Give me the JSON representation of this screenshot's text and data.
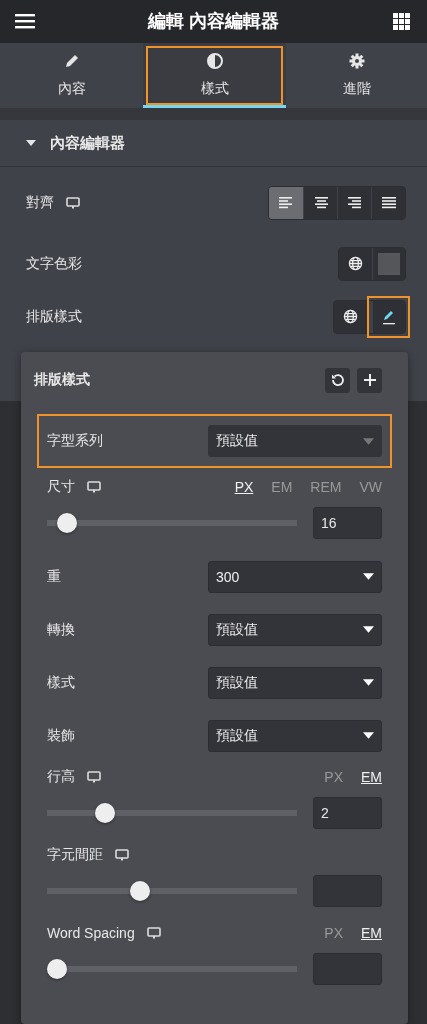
{
  "header": {
    "title": "編輯 內容編輯器"
  },
  "tabs": [
    {
      "label": "內容",
      "selected": false,
      "highlighted": false
    },
    {
      "label": "樣式",
      "selected": true,
      "highlighted": true
    },
    {
      "label": "進階",
      "selected": false,
      "highlighted": false
    }
  ],
  "section": {
    "title": "內容編輯器",
    "expanded": true
  },
  "controls": [
    {
      "kind": "align",
      "label": "對齊",
      "responsive": true,
      "options": [
        {
          "selected": true
        },
        {
          "selected": false
        },
        {
          "selected": false
        },
        {
          "selected": false
        }
      ]
    },
    {
      "kind": "color",
      "label": "文字色彩"
    },
    {
      "kind": "typography",
      "label": "排版樣式",
      "editing": true,
      "highlighted": true
    }
  ],
  "popover": {
    "title": "排版樣式",
    "fields": [
      {
        "kind": "select",
        "label": "字型系列",
        "value": "預設值",
        "highlighted": true,
        "disabled": true
      },
      {
        "kind": "slider",
        "label": "尺寸",
        "responsive": true,
        "units": [
          {
            "label": "PX",
            "selected": true
          },
          {
            "label": "EM",
            "selected": false
          },
          {
            "label": "REM",
            "selected": false
          },
          {
            "label": "VW",
            "selected": false
          }
        ],
        "level": 0.04,
        "value": "16"
      },
      {
        "kind": "select",
        "label": "重",
        "value": "300",
        "disabled": false
      },
      {
        "kind": "select",
        "label": "轉換",
        "value": "預設值",
        "disabled": false
      },
      {
        "kind": "select",
        "label": "樣式",
        "value": "預設值",
        "disabled": false
      },
      {
        "kind": "select",
        "label": "裝飾",
        "value": "預設值",
        "disabled": false
      },
      {
        "kind": "slider",
        "label": "行高",
        "responsive": true,
        "units": [
          {
            "label": "PX",
            "selected": false
          },
          {
            "label": "EM",
            "selected": true
          }
        ],
        "level": 0.19,
        "value": "2"
      },
      {
        "kind": "slider",
        "label": "字元間距",
        "responsive": true,
        "level": 0.33
      },
      {
        "kind": "slider",
        "label": "Word Spacing",
        "responsive": true,
        "units": [
          {
            "label": "PX",
            "selected": false
          },
          {
            "label": "EM",
            "selected": true
          }
        ],
        "level": 0
      }
    ]
  }
}
